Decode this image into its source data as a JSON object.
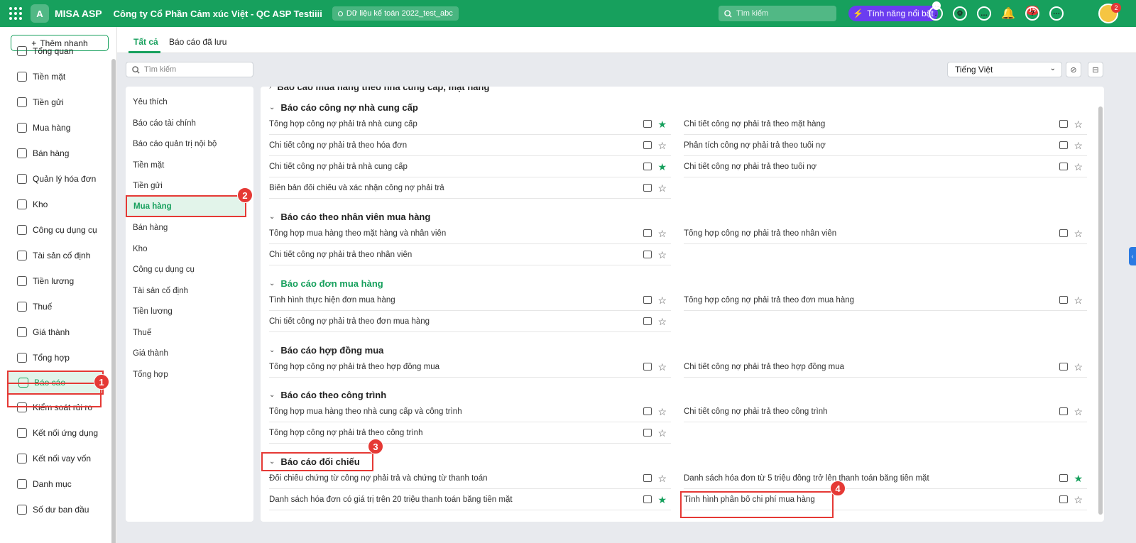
{
  "topbar": {
    "app_name": "MISA ASP",
    "logo_letter": "A",
    "company": "Công ty Cổ Phần Cảm xúc Việt - QC ASP Testiiii",
    "database": "Dữ liệu kế toán 2022_test_abc",
    "search_placeholder": "Tìm kiếm",
    "feature_label": "Tính năng nổi bật",
    "notification_count": "15",
    "avatar_badge": "2",
    "accent": "#17a05d"
  },
  "sidebar": {
    "add_label": "Thêm nhanh",
    "items": [
      {
        "label": "Tổng quan"
      },
      {
        "label": "Tiền mặt"
      },
      {
        "label": "Tiền gửi"
      },
      {
        "label": "Mua hàng"
      },
      {
        "label": "Bán hàng"
      },
      {
        "label": "Quản lý hóa đơn"
      },
      {
        "label": "Kho"
      },
      {
        "label": "Công cụ dụng cụ"
      },
      {
        "label": "Tài sản cố định"
      },
      {
        "label": "Tiền lương"
      },
      {
        "label": "Thuế"
      },
      {
        "label": "Giá thành"
      },
      {
        "label": "Tổng hợp"
      },
      {
        "label": "Báo cáo"
      },
      {
        "label": "Kiểm soát rủi ro"
      },
      {
        "label": "Kết nối ứng dụng"
      },
      {
        "label": "Kết nối vay vốn"
      },
      {
        "label": "Danh mục"
      },
      {
        "label": "Số dư ban đầu"
      }
    ],
    "active": "Báo cáo"
  },
  "tabs": {
    "all": "Tất cả",
    "saved": "Báo cáo đã lưu"
  },
  "filter": {
    "search_placeholder": "Tìm kiếm",
    "language": "Tiếng Việt"
  },
  "categories": [
    "Yêu thích",
    "Báo cáo tài chính",
    "Báo cáo quản trị nội bộ",
    "Tiền mặt",
    "Tiền gửi",
    "Mua hàng",
    "Bán hàng",
    "Kho",
    "Công cụ dụng cụ",
    "Tài sản cố định",
    "Tiền lương",
    "Thuế",
    "Giá thành",
    "Tổng hợp"
  ],
  "reports": {
    "partial_group": "Báo cáo mua hàng theo nhà cung cấp, mặt hàng",
    "groups": [
      {
        "title": "Báo cáo công nợ nhà cung cấp",
        "left": [
          "Tổng hợp công nợ phải trả nhà cung cấp",
          "Chi tiết công nợ phải trả theo hóa đơn",
          "Chi tiết công nợ phải trả nhà cung cấp",
          "Biên bản đối chiếu và xác nhận công nợ phải trả"
        ],
        "right": [
          "Chi tiết công nợ phải trả theo mặt hàng",
          "Phân tích công nợ phải trả theo tuổi nợ",
          "Chi tiết công nợ phải trả theo tuổi nợ"
        ]
      },
      {
        "title": "Báo cáo theo nhân viên mua hàng",
        "left": [
          "Tổng hợp mua hàng theo mặt hàng và nhân viên",
          "Chi tiết công nợ phải trả theo nhân viên"
        ],
        "right": [
          "Tổng hợp công nợ phải trả theo nhân viên"
        ]
      },
      {
        "title": "Báo cáo đơn mua hàng",
        "left": [
          "Tình hình thực hiện đơn mua hàng",
          "Chi tiết công nợ phải trả theo đơn mua hàng"
        ],
        "right": [
          "Tổng hợp công nợ phải trả theo đơn mua hàng"
        ]
      },
      {
        "title": "Báo cáo hợp đồng mua",
        "left": [
          "Tổng hợp công nợ phải trả theo hợp đồng mua"
        ],
        "right": [
          "Chi tiết công nợ phải trả theo hợp đồng mua"
        ]
      },
      {
        "title": "Báo cáo theo công trình",
        "left": [
          "Tổng hợp mua hàng theo nhà cung cấp và công trình",
          "Tổng hợp công nợ phải trả theo công trình"
        ],
        "right": [
          "Chi tiết công nợ phải trả theo công trình"
        ]
      },
      {
        "title": "Báo cáo đối chiếu",
        "left": [
          "Đối chiếu chứng từ công nợ phải trả và chứng từ thanh toán",
          "Danh sách hóa đơn có giá trị trên 20 triệu thanh toán bằng tiền mặt"
        ],
        "right": [
          "Danh sách hóa đơn từ 5 triệu đồng trở lên thanh toán bằng tiền mặt",
          "Tình hình phân bổ chi phí mua hàng"
        ]
      }
    ]
  },
  "markers": [
    "1",
    "2",
    "3",
    "4"
  ]
}
